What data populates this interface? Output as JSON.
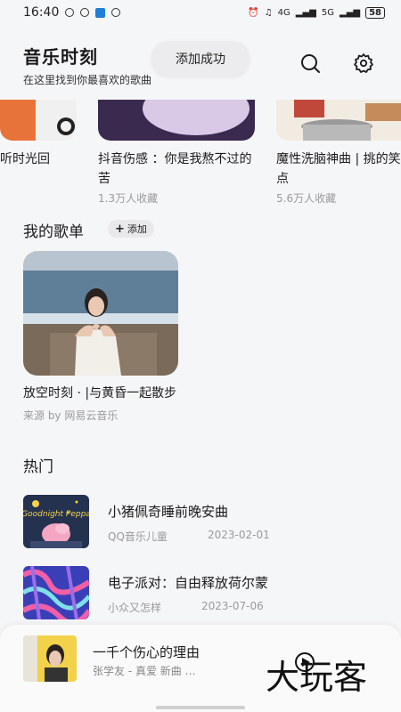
{
  "status_bar": {
    "time": "16:40",
    "network": "4G",
    "network2": "5G",
    "battery": "58"
  },
  "header": {
    "title": "音乐时刻",
    "subtitle": "在这里找到你最喜欢的歌曲",
    "toast": "添加成功"
  },
  "recommendations": [
    {
      "title": "听时光回",
      "count": ""
    },
    {
      "title": "抖音伤感 ：你是我熬不过的苦",
      "count": "1.3万人收藏"
    },
    {
      "title": "魔性洗脑神曲 | 挑的笑点",
      "count": "5.6万人收藏"
    }
  ],
  "my_playlists": {
    "title": "我的歌单",
    "add_label": "添加",
    "items": [
      {
        "title": "放空时刻 · |与黄昏一起散步",
        "source": "来源 by 网易云音乐"
      }
    ]
  },
  "hot": {
    "title": "热门",
    "items": [
      {
        "title": "小猪佩奇睡前晚安曲",
        "source": "QQ音乐儿童",
        "date": "2023-02-01",
        "thumb_text": "Goodnight Peppa"
      },
      {
        "title": "电子派对：自由释放荷尔蒙",
        "source": "小众又怎样",
        "date": "2023-07-06",
        "thumb_text": ""
      }
    ]
  },
  "player": {
    "title": "一千个伤心的理由",
    "artist": "张学友 - 真爱 新曲 …"
  },
  "watermark": "大玩客",
  "icons": {
    "search": "search-icon",
    "settings": "gear-icon",
    "add": "plus-icon"
  },
  "colors": {
    "background": "#f5f6f8",
    "secondary_text": "#9a9a9a",
    "chip": "#e9e9ec"
  }
}
